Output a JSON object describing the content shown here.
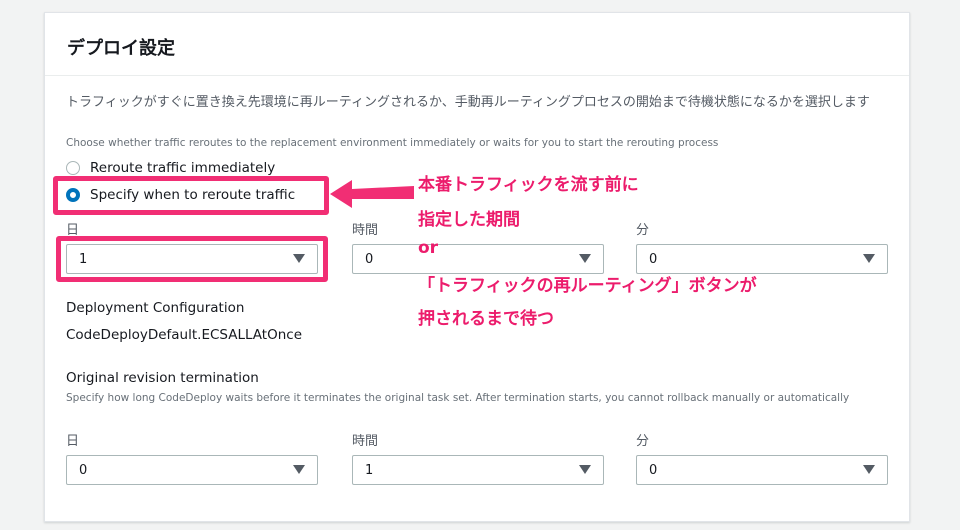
{
  "panel": {
    "title": "デプロイ設定",
    "description_jp": "トラフィックがすぐに置き換え先環境に再ルーティングされるか、手動再ルーティングプロセスの開始まで待機状態になるかを選択します",
    "description_en": "Choose whether traffic reroutes to the replacement environment immediately or waits for you to start the rerouting process",
    "radio_options": [
      {
        "label": "Reroute traffic immediately",
        "checked": false
      },
      {
        "label": "Specify when to reroute traffic",
        "checked": true
      }
    ],
    "wait_fields": [
      {
        "label": "日",
        "value": "1"
      },
      {
        "label": "時間",
        "value": "0"
      },
      {
        "label": "分",
        "value": "0"
      }
    ],
    "deployment_config": {
      "label": "Deployment Configuration",
      "value": "CodeDeployDefault.ECSALLAtOnce"
    },
    "termination": {
      "label": "Original revision termination",
      "description": "Specify how long CodeDeploy waits before it terminates the original task set. After termination starts, you cannot rollback manually or automatically",
      "fields": [
        {
          "label": "日",
          "value": "0"
        },
        {
          "label": "時間",
          "value": "1"
        },
        {
          "label": "分",
          "value": "0"
        }
      ]
    }
  },
  "annotation": {
    "lines": [
      "本番トラフィックを流す前に",
      "指定した期間",
      "or",
      "「トラフィックの再ルーティング」ボタンが",
      "押されるまで待つ"
    ],
    "color": "#ec1c6c"
  },
  "colors": {
    "accent": "#0073bb",
    "highlight": "#f12e74"
  }
}
